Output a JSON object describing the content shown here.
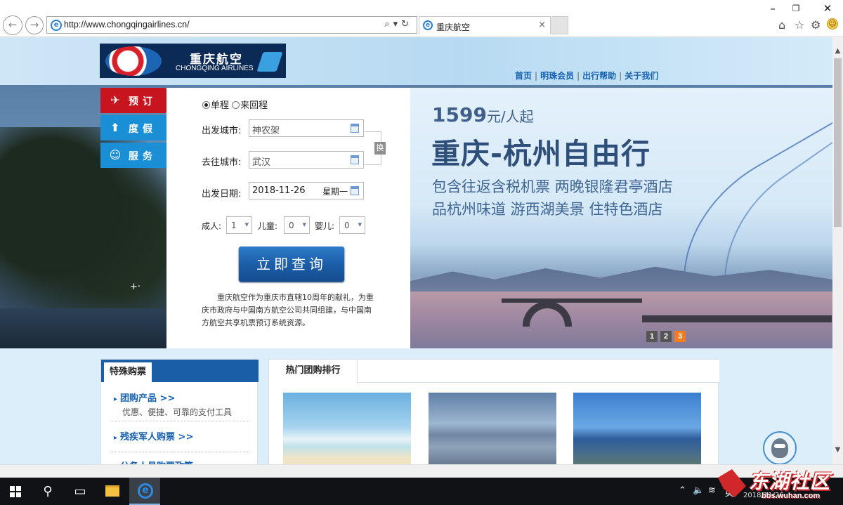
{
  "browser": {
    "url": "http://www.chongqingairlines.cn/",
    "tab_title": "重庆航空",
    "tab_close": "×",
    "back_glyph": "←",
    "forward_glyph": "→",
    "address_tools": "⌕▾↻",
    "win_min": "–",
    "win_max": "❐",
    "win_close": "✕"
  },
  "header": {
    "logo_cn": "重庆航空",
    "logo_en": "CHONGQING AIRLINES",
    "nav": [
      {
        "label": "首页"
      },
      {
        "label": "明珠会员"
      },
      {
        "label": "出行帮助"
      },
      {
        "label": "关于我们"
      }
    ],
    "nav_sep": "|"
  },
  "side_tabs": [
    {
      "label": "预订",
      "icon": "plane-icon"
    },
    {
      "label": "度假",
      "icon": "arrow-up-icon"
    },
    {
      "label": "服务",
      "icon": "person-icon"
    }
  ],
  "booking": {
    "trip_types": [
      {
        "label": "单程",
        "checked": true
      },
      {
        "label": "来回程",
        "checked": false
      }
    ],
    "depart_city_label": "出发城市:",
    "depart_city_value": "神农架",
    "arrive_city_label": "去往城市:",
    "arrive_city_value": "武汉",
    "swap_label": "换",
    "date_label": "出发日期:",
    "date_value": "2018-11-26",
    "weekday": "星期一",
    "adult_label": "成人:",
    "adult_value": "1",
    "child_label": "儿童:",
    "child_value": "0",
    "infant_label": "婴儿:",
    "infant_value": "0",
    "search_label": "立即查询",
    "intro": "重庆航空作为重庆市直辖10周年的献礼，为重庆市政府与中国南方航空公司共同组建，与中国南方航空共享机票预订系统资源。"
  },
  "promo": {
    "price": "1599",
    "price_unit": "元/人起",
    "title": "重庆-杭州自由行",
    "line1": "包含往返含税机票 两晚银隆君亭酒店",
    "line2": "品杭州味道 游西湖美景 住特色酒店",
    "slides": [
      {
        "label": "1",
        "active": false
      },
      {
        "label": "2",
        "active": false
      },
      {
        "label": "3",
        "active": true
      }
    ]
  },
  "special": {
    "tab_label": "特殊购票",
    "items": [
      {
        "title": "团购产品 >>",
        "desc": "优惠、便捷、可靠的支付工具"
      },
      {
        "title": "残疾军人购票 >>",
        "desc": ""
      },
      {
        "title": "公务人员购票政策",
        "desc": ""
      }
    ]
  },
  "hot": {
    "tab_label": "热门团购排行"
  },
  "taskbar": {
    "tray_up": "⌃",
    "tray_vol": "🔈",
    "tray_net": "≋",
    "tray_ime": "英",
    "clock": "2018/11/26"
  },
  "watermark": {
    "text": "东湖社区",
    "url": "bbs.wuhan.com"
  },
  "colors": {
    "accent_red": "#c8141e",
    "accent_blue": "#1a8fd6",
    "button_blue": "#1c5ea8",
    "link_blue": "#1560b0",
    "slide_active": "#f47c20"
  }
}
